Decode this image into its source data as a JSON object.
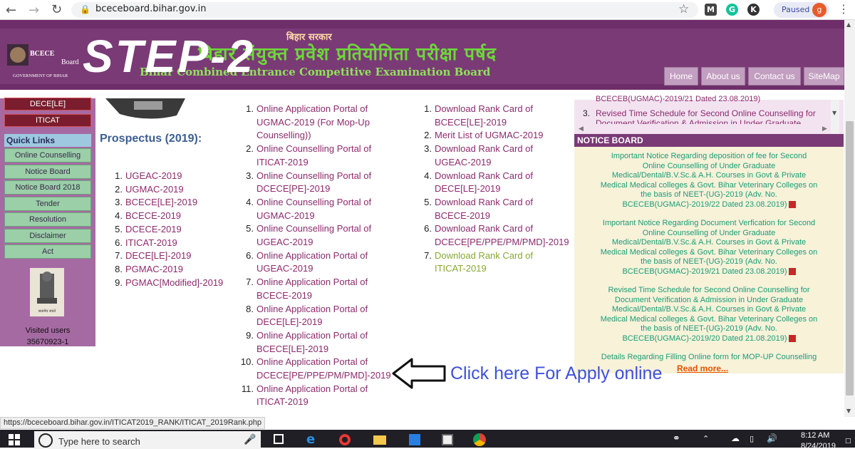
{
  "browser": {
    "url": "bceceboard.bihar.gov.in",
    "paused_label": "Paused",
    "profile_initial": "g",
    "ext_labels": [
      "M",
      "G",
      "K"
    ]
  },
  "header": {
    "govt_label": "बिहार सरकार",
    "hindi_title": "बिहार संयुक्त प्रवेश प्रतियोगिता परीक्षा पर्षद",
    "english_title": "Bihar Combined Entrance Competitive Examination Board",
    "step_label": "STEP-2",
    "logo_text_top": "BCECE",
    "logo_text_board": "Board",
    "logo_text_govt": "GOVERNMENT OF BIHAR",
    "tabs": [
      "Home",
      "About us",
      "Contact us",
      "SiteMap"
    ]
  },
  "sidebar": {
    "top_items": [
      "DECE[LE]",
      "ITICAT"
    ],
    "quick_links_title": "Quick Links",
    "quick_links": [
      "Online Counselling",
      "Notice Board",
      "Notice Board 2018",
      "Tender",
      "Resolution",
      "Disclaimer",
      "Act"
    ],
    "emblem_caption": "सत्यमेव जयते",
    "visited_label": "Visited users",
    "visited_count": "35670923-1"
  },
  "prospectus": {
    "heading": "Prospectus (2019):",
    "items": [
      "UGEAC-2019",
      "UGMAC-2019",
      "BCECE[LE]-2019",
      "BCECE-2019",
      "DCECE-2019",
      "ITICAT-2019",
      "DECE[LE]-2019",
      "PGMAC-2019",
      "PGMAC[Modified]-2019"
    ]
  },
  "portals": {
    "items": [
      [
        "Online Application Portal of",
        "UGMAC-2019 (For Mop-Up",
        "Counselling))"
      ],
      [
        "Online Counselling Portal of",
        "ITICAT-2019"
      ],
      [
        "Online Counselling Portal of",
        "DCECE[PE]-2019"
      ],
      [
        "Online Counselling Portal of",
        "UGMAC-2019"
      ],
      [
        "Online Counselling Portal of",
        "UGEAC-2019"
      ],
      [
        "Online Application Portal of",
        "UGEAC-2019"
      ],
      [
        "Online Application Portal of",
        "BCECE-2019"
      ],
      [
        "Online Application Portal of",
        "DECE[LE]-2019"
      ],
      [
        "Online Application Portal of",
        "BCECE[LE]-2019"
      ],
      [
        "Online Application Portal of",
        "DCECE[PE/PPE/PM/PMD]-2019"
      ],
      [
        "Online Application Portal of",
        "ITICAT-2019"
      ]
    ]
  },
  "rank_cards": {
    "items": [
      [
        "Download Rank Card of",
        "BCECE[LE]-2019"
      ],
      [
        "Merit List of UGMAC-2019"
      ],
      [
        "Download Rank Card of",
        "UGEAC-2019"
      ],
      [
        "Download Rank Card of",
        "DECE[LE]-2019"
      ],
      [
        "Download Rank Card of",
        "BCECE-2019"
      ],
      [
        "Download Rank Card of",
        "DCECE[PE/PPE/PM/PMD]-2019"
      ],
      [
        "Download Rank Card of",
        "ITICAT-2019"
      ]
    ],
    "highlight_index": 6
  },
  "right_panel": {
    "top_lines": [
      "BCECEB(UGMAC)-2019/21 Dated 23.08.2019)",
      "Revised Time Schedule for Second Online Counselling for",
      "Document Verification & Admission in Under Graduate"
    ],
    "top_number": "3.",
    "notice_title": "NOTICE BOARD",
    "notices": [
      [
        "Important Notice Regarding deposition of fee for Second",
        "Online Counselling of Under Graduate",
        "Medical/Dental/B.V.Sc.& A.H. Courses in Govt & Private",
        "Medical Medical colleges & Govt. Bihar Veterinary Colleges on",
        "the basis of NEET-(UG)-2019 (Adv. No.",
        "BCECEB(UGMAC)-2019/22 Dated 23.08.2019)"
      ],
      [
        "Important Notice Regarding Document Verfication for Second",
        "Online Counselling of Under Graduate",
        "Medical/Dental/B.V.Sc.& A.H. Courses in Govt & Private",
        "Medical Medical colleges & Govt. Bihar Veterinary Colleges on",
        "the basis of NEET-(UG)-2019 (Adv. No.",
        "BCECEB(UGMAC)-2019/21 Dated 23.08.2019)"
      ],
      [
        "Revised Time Schedule for Second Online Counselling for",
        "Document Verification & Admission in Under Graduate",
        "Medical/Dental/B.V.Sc.& A.H. Courses in Govt & Private",
        "Medical Medical colleges & Govt. Bihar Veterinary Colleges on",
        "the basis of NEET-(UG)-2019 (Adv. No.",
        "BCECEB(UGMAC)-2019/20 Dated 21.08.2019)"
      ],
      [
        "Details Regarding Filling Online form for MOP-UP Counselling"
      ]
    ],
    "read_more": "Read more..."
  },
  "annotation": {
    "text": "Click here For Apply online"
  },
  "status_bar": {
    "url": "https://bceceboard.bihar.gov.in/ITICAT2019_RANK/ITICAT_2019Rank.php"
  },
  "taskbar": {
    "search_placeholder": "Type here to search",
    "time": "8:12 AM",
    "date": "8/24/2019"
  },
  "colors": {
    "header_purple": "#7a3a76",
    "link_purple": "#8c2b6e",
    "notice_green": "#1b9c7a",
    "annotation_blue": "#3f51d9"
  }
}
